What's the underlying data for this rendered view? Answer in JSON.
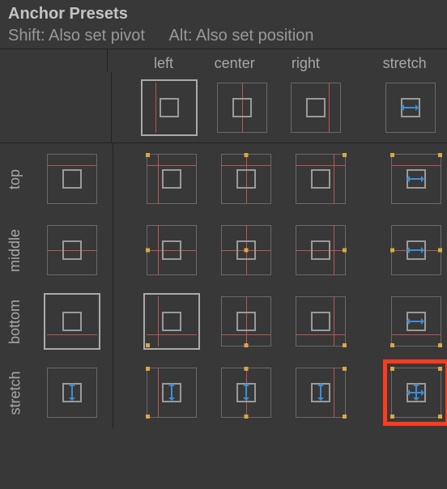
{
  "header": {
    "title": "Anchor Presets",
    "shift_hint": "Shift: Also set pivot",
    "alt_hint": "Alt: Also set position"
  },
  "columns": {
    "left": "left",
    "center": "center",
    "right": "right",
    "stretch": "stretch"
  },
  "rows": {
    "top": "top",
    "middle": "middle",
    "bottom": "bottom",
    "stretch": "stretch"
  },
  "selected_column": "left",
  "selected_row": "bottom",
  "highlighted": "stretch-stretch"
}
